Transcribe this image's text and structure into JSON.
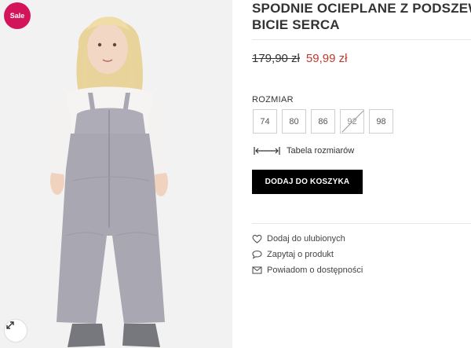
{
  "badge": {
    "label": "Sale"
  },
  "product": {
    "title": "SPODNIE OCIEPLANE Z PODSZEWKĄ BICIE SERCA",
    "title_line1": "SPODNIE OCIEPLANE Z PODSZEWKĄ",
    "title_line2": "BICIE SERCA",
    "old_price": "179,90 zł",
    "new_price": "59,99 zł"
  },
  "size_section": {
    "label": "ROZMIAR",
    "options": [
      {
        "value": "74",
        "available": true
      },
      {
        "value": "80",
        "available": true
      },
      {
        "value": "86",
        "available": true
      },
      {
        "value": "92",
        "available": false
      },
      {
        "value": "98",
        "available": true
      }
    ],
    "size_table_label": "Tabela rozmiarów"
  },
  "cart": {
    "button_label": "DODAJ DO KOSZYKA"
  },
  "actions": [
    {
      "label": "Dodaj do ulubionych",
      "icon": "heart-icon"
    },
    {
      "label": "Zapytaj o produkt",
      "icon": "speech-bubble-icon"
    },
    {
      "label": "Powiadom o dostępności",
      "icon": "envelope-icon"
    }
  ],
  "colors": {
    "sale": "#d4145a",
    "price": "#c0392b",
    "button": "#000000",
    "pants": "#a9a7b1"
  }
}
